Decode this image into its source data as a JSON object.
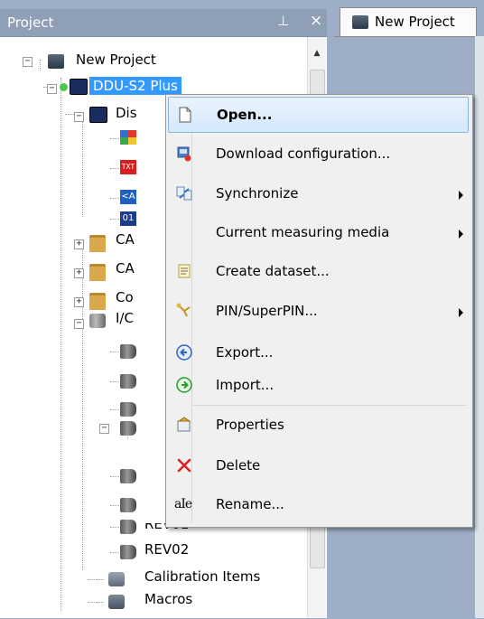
{
  "panel": {
    "title": "Project",
    "pin_glyph": "⊥",
    "close_glyph": "×"
  },
  "document_tab": {
    "label": "New Project",
    "icon": "project-icon"
  },
  "tree": {
    "root": "New Project",
    "device": "DDU-S2 Plus",
    "items": [
      {
        "label": "Dis",
        "icon": "device-icon"
      },
      {
        "label": "",
        "icon": "dashboard-icon"
      },
      {
        "label": "",
        "icon": "text-icon"
      },
      {
        "label": "",
        "icon": "variable-icon"
      },
      {
        "label": "",
        "icon": "bitmap-icon"
      },
      {
        "label": "CA",
        "icon": "folder-icon"
      },
      {
        "label": "CA",
        "icon": "folder-icon"
      },
      {
        "label": "Co",
        "icon": "folder-icon"
      },
      {
        "label": "I/C",
        "icon": "io-icon"
      },
      {
        "label": "REV01",
        "icon": "plug-icon"
      },
      {
        "label": "REV02",
        "icon": "plug-icon"
      },
      {
        "label": "Calibration Items",
        "icon": "calibration-icon"
      },
      {
        "label": "Macros",
        "icon": "macro-icon"
      }
    ]
  },
  "context_menu": {
    "items": [
      {
        "label": "Open...",
        "icon": "open-document-icon",
        "submenu": false,
        "highlighted": true
      },
      {
        "label": "Download configuration...",
        "icon": "download-icon",
        "submenu": false
      },
      {
        "label": "Synchronize",
        "icon": "synchronize-icon",
        "submenu": true
      },
      {
        "label": "Current measuring media",
        "icon": "",
        "submenu": true
      },
      {
        "label": "Create dataset...",
        "icon": "dataset-icon",
        "submenu": false
      },
      {
        "label": "PIN/SuperPIN...",
        "icon": "pin-key-icon",
        "submenu": true
      },
      {
        "label": "Export...",
        "icon": "export-arrow-icon",
        "submenu": false
      },
      {
        "label": "Import...",
        "icon": "import-arrow-icon",
        "submenu": false
      },
      {
        "label": "Properties",
        "icon": "properties-icon",
        "submenu": false
      },
      {
        "label": "Delete",
        "icon": "delete-x-icon",
        "submenu": false
      },
      {
        "label": "Rename...",
        "icon": "rename-icon",
        "submenu": false
      }
    ],
    "rename_icon_text": "aIe"
  },
  "colors": {
    "selection": "#3399ff",
    "panel_header": "#8e9fb6",
    "background": "#9daec6",
    "menu_highlight_border": "#8cb5e6",
    "delete_red": "#e02020"
  }
}
